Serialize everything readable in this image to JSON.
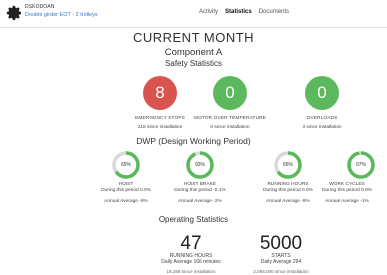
{
  "header": {
    "device_id": "DSKODOAN",
    "device_name": "Double girder EOT - 2 trolleys",
    "tabs": [
      {
        "label": "Activity"
      },
      {
        "label": "Statistics"
      },
      {
        "label": "Documents"
      }
    ],
    "active_tab": "Statistics"
  },
  "title": "CURRENT MONTH",
  "component": "Component A",
  "safety_title": "Safety Statistics",
  "safety": [
    {
      "value": "8",
      "label": "EMERGENCY STOPS",
      "sub": "218 since installation",
      "color": "#d9534f"
    },
    {
      "value": "0",
      "label": "MOTOR OVER TEMPERATURE",
      "sub": "0 since installation",
      "color": "#5cb85c"
    },
    {
      "value": "0",
      "label": "OVERLOADS",
      "sub": "3 since installation",
      "color": "#5cb85c"
    }
  ],
  "dwp_title": "DWP (Design Working Period)",
  "dwp": [
    {
      "pct_label": "65%",
      "pct": 0.65,
      "label": "HOIST",
      "period": "During this period 0.0%",
      "avg": "Annual Average -8%"
    },
    {
      "pct_label": "93%",
      "pct": 0.93,
      "label": "HOIST BRAKE",
      "period": "During this period -0.1%",
      "avg": "Annual Average -2%"
    },
    {
      "pct_label": "65%",
      "pct": 0.65,
      "label": "RUNNING HOURS",
      "period": "During this period 0.0%",
      "avg": "Annual Average -8%"
    },
    {
      "pct_label": "97%",
      "pct": 0.97,
      "label": "WORK CYCLES",
      "period": "During this period 0.0%",
      "avg": "Annual Average -1%"
    }
  ],
  "ops_title": "Operating Statistics",
  "ops": [
    {
      "value": "47",
      "label": "RUNNING HOURS",
      "daily": "Daily Average 166 minutes",
      "since": "19,288 since installation"
    },
    {
      "value": "5000",
      "label": "STARTS",
      "daily": "Daily Average 294",
      "since": "2,058,000 since installation"
    }
  ],
  "colors": {
    "green": "#5cb85c",
    "red": "#d9534f",
    "link": "#3a78c9",
    "track": "#d9d9d9"
  }
}
